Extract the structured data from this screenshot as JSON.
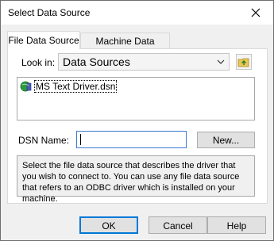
{
  "window": {
    "title": "Select Data Source"
  },
  "tabs": [
    {
      "label": "File Data Source",
      "active": true
    },
    {
      "label": "Machine Data Source",
      "active": false
    }
  ],
  "look_in": {
    "label": "Look in:",
    "value": "Data Sources"
  },
  "files": [
    {
      "name": "MS Text Driver.dsn"
    }
  ],
  "dsn": {
    "label": "DSN Name:",
    "value": ""
  },
  "buttons": {
    "new": "New...",
    "ok": "OK",
    "cancel": "Cancel",
    "help": "Help"
  },
  "description": "Select the file data source that describes the driver that you wish to connect to. You can use any file data source that refers to an ODBC driver which is installed on your machine.",
  "colors": {
    "focus": "#0078d7",
    "dialog_bg": "#f0f0f0",
    "panel_bg": "#ffffff"
  }
}
